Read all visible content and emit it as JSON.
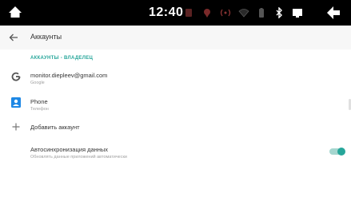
{
  "statusbar": {
    "time": "12:40",
    "icons": [
      "home-icon",
      "no-sim-icon",
      "location-off-icon",
      "wireless-signal-icon",
      "wifi-icon",
      "battery-icon",
      "bluetooth-icon",
      "display-icon",
      "back-icon"
    ]
  },
  "header": {
    "title": "Аккаунты"
  },
  "section": {
    "label": "АККАУНТЫ - ВЛАДЕЛЕЦ"
  },
  "accounts": [
    {
      "title": "monitor.diepleev@gmail.com",
      "subtitle": "Google",
      "icon": "google-icon"
    },
    {
      "title": "Phone",
      "subtitle": "Телефон",
      "icon": "contacts-icon"
    }
  ],
  "add_account": {
    "label": "Добавить аккаунт"
  },
  "autosync": {
    "title": "Автосинхронизация данных",
    "subtitle": "Обновлять данные приложений автоматически",
    "enabled": true
  },
  "colors": {
    "accent": "#26a69a",
    "statusbar": "#000000",
    "toolbar": "#f7f7f7"
  }
}
